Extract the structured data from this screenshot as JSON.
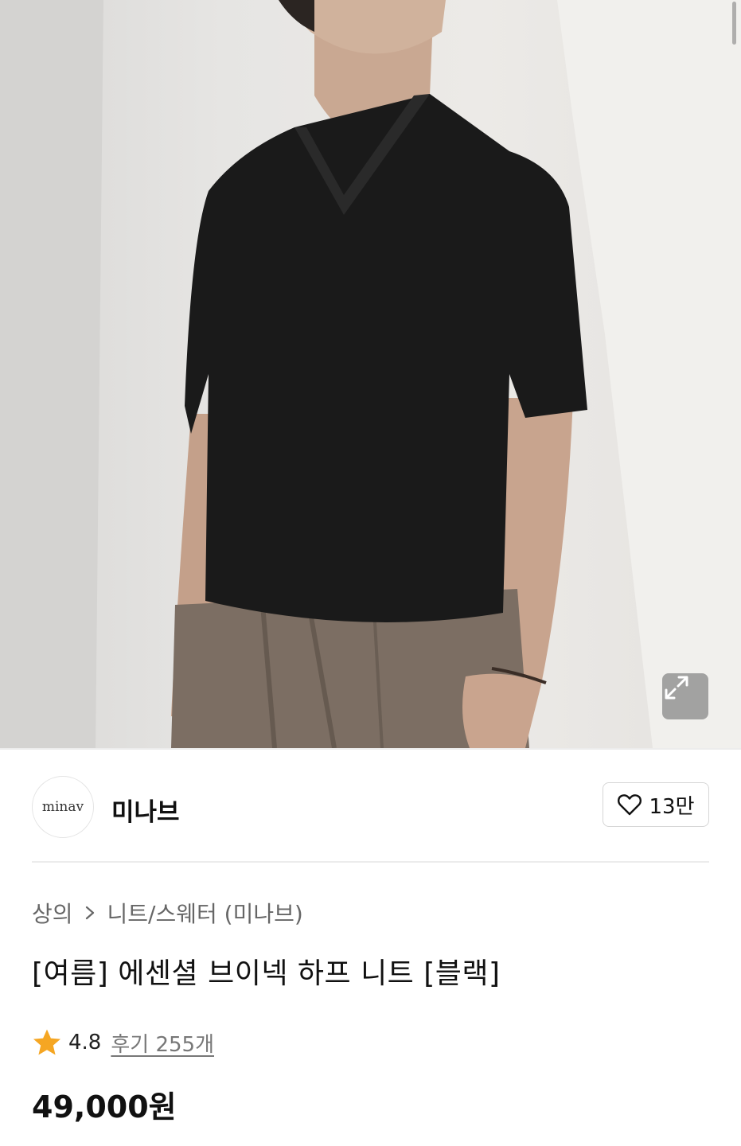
{
  "product_image": {
    "alt": "black v-neck half-sleeve knit"
  },
  "brand": {
    "logo_text": "minav",
    "name": "미나브",
    "likes": "13만"
  },
  "breadcrumb": [
    "상의",
    "니트/스웨터 (미나브)"
  ],
  "product": {
    "title": "[여름] 에센셜 브이넥 하프 니트 [블랙]",
    "rating": "4.8",
    "reviews": "후기 255개",
    "price": "49,000원"
  },
  "colors": {
    "star": "#f5a623",
    "text_primary": "#111111",
    "text_secondary": "#666666"
  }
}
